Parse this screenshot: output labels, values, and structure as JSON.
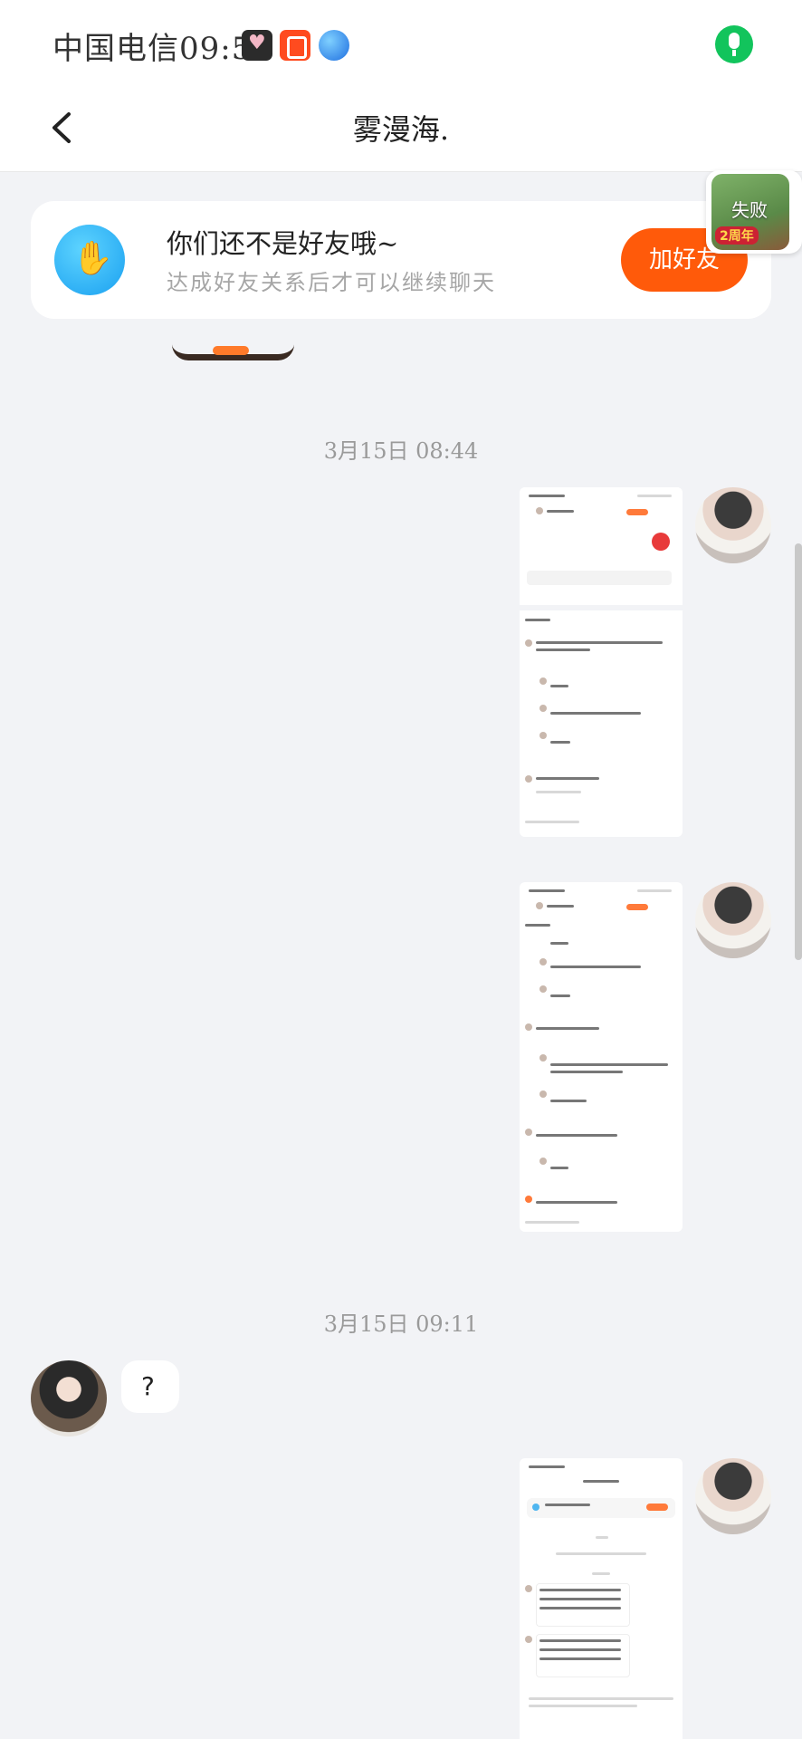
{
  "status_bar": {
    "carrier_time": "中国电信09:51",
    "icons": [
      "heart-app-icon",
      "kuaishou-icon",
      "planet-icon",
      "microphone-icon"
    ]
  },
  "header": {
    "title": "雾漫海."
  },
  "friend_banner": {
    "title": "你们还不是好友哦~",
    "subtitle": "达成好友关系后才可以继续聊天",
    "button": "加好友"
  },
  "float_widget": {
    "label": "失败",
    "badge": "2周年"
  },
  "timestamps": [
    "3月15日 08:44",
    "3月15日 09:11"
  ],
  "messages": [
    {
      "sender": "self",
      "type": "screenshot"
    },
    {
      "sender": "self",
      "type": "screenshot"
    },
    {
      "sender": "other",
      "type": "text",
      "text": "?"
    },
    {
      "sender": "self",
      "type": "screenshot"
    }
  ],
  "colors": {
    "accent": "#ff5a0a",
    "mic": "#12c45c",
    "background": "#f2f3f6"
  }
}
